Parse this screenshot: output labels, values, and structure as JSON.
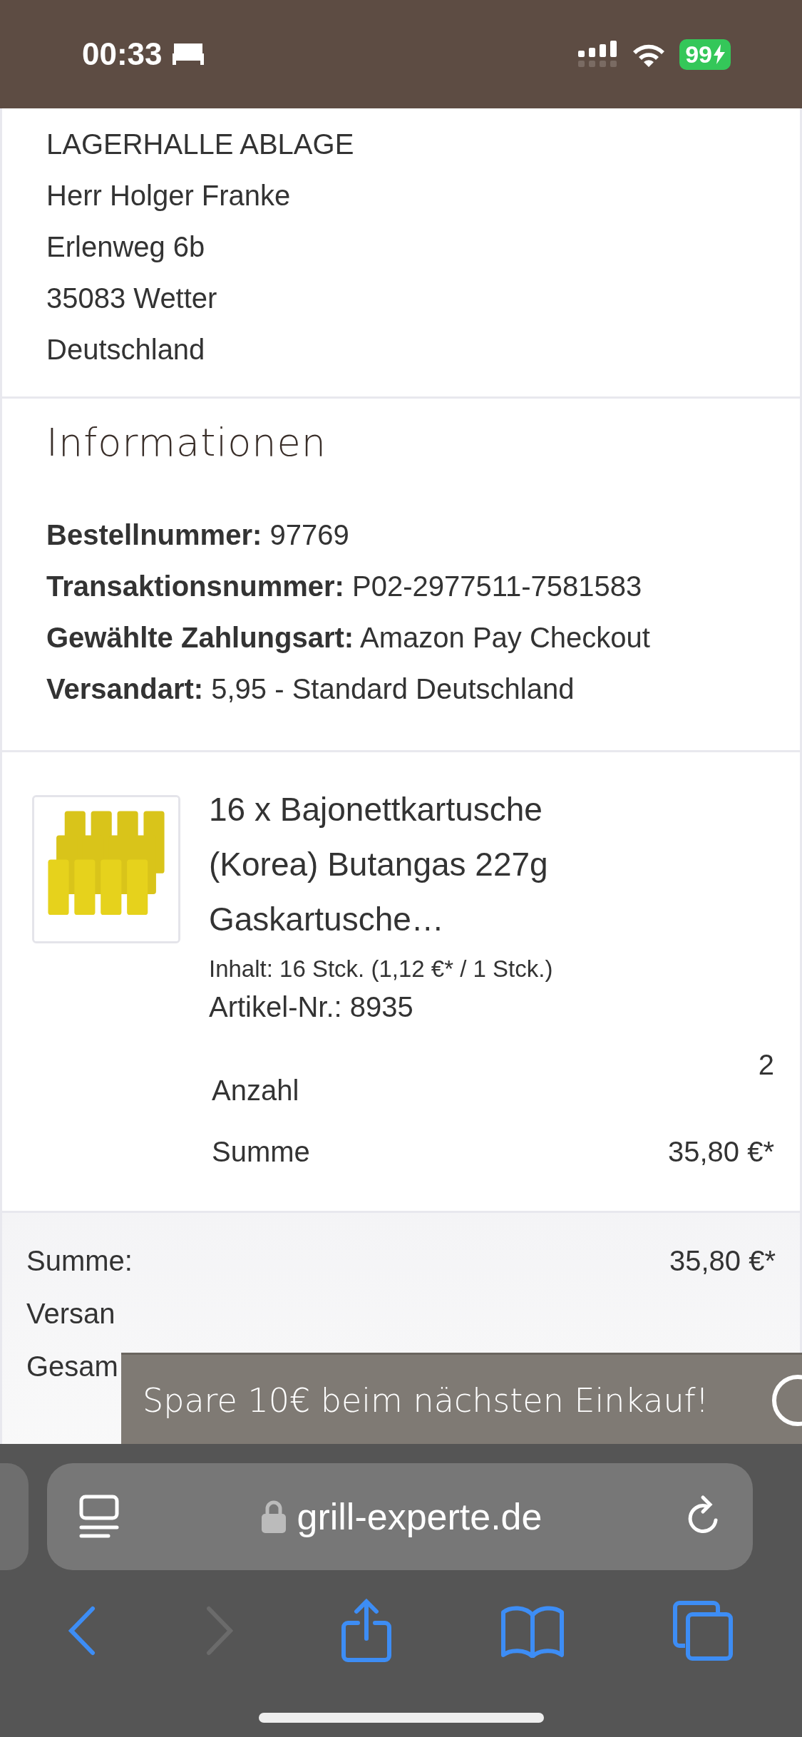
{
  "status_bar": {
    "time": "00:33",
    "battery": "99"
  },
  "address": [
    "LAGERHALLE ABLAGE",
    "Herr Holger Franke",
    "Erlenweg 6b",
    "35083 Wetter",
    "Deutschland"
  ],
  "info": {
    "title": "Informationen",
    "rows": [
      {
        "label": "Bestellnummer:",
        "value": "97769"
      },
      {
        "label": "Transaktionsnummer:",
        "value": "P02-2977511-7581583"
      },
      {
        "label": "Gewählte Zahlungsart:",
        "value": "Amazon Pay Checkout"
      },
      {
        "label": "Versandart:",
        "value": "5,95 - Standard Deutschland"
      }
    ]
  },
  "item": {
    "title": "16 x Bajonettkartusche (Korea) Butangas 227g Gaskartusche…",
    "details": "Inhalt: 16 Stck. (1,12 €* / 1 Stck.)",
    "article": "Artikel-Nr.: 8935",
    "quantity": {
      "label": "Anzahl",
      "value": "2"
    },
    "sum": {
      "label": "Summe",
      "value": "35,80 €*"
    }
  },
  "totals": [
    {
      "label": "Summe:",
      "value": "35,80 €*"
    },
    {
      "label": "Versan"
    },
    {
      "label": "Gesam"
    }
  ],
  "banner": {
    "text": "Spare 10€ beim nächsten Einkauf!"
  },
  "browser": {
    "url": "grill-experte.de",
    "back_disabled": false,
    "forward_disabled": true
  }
}
